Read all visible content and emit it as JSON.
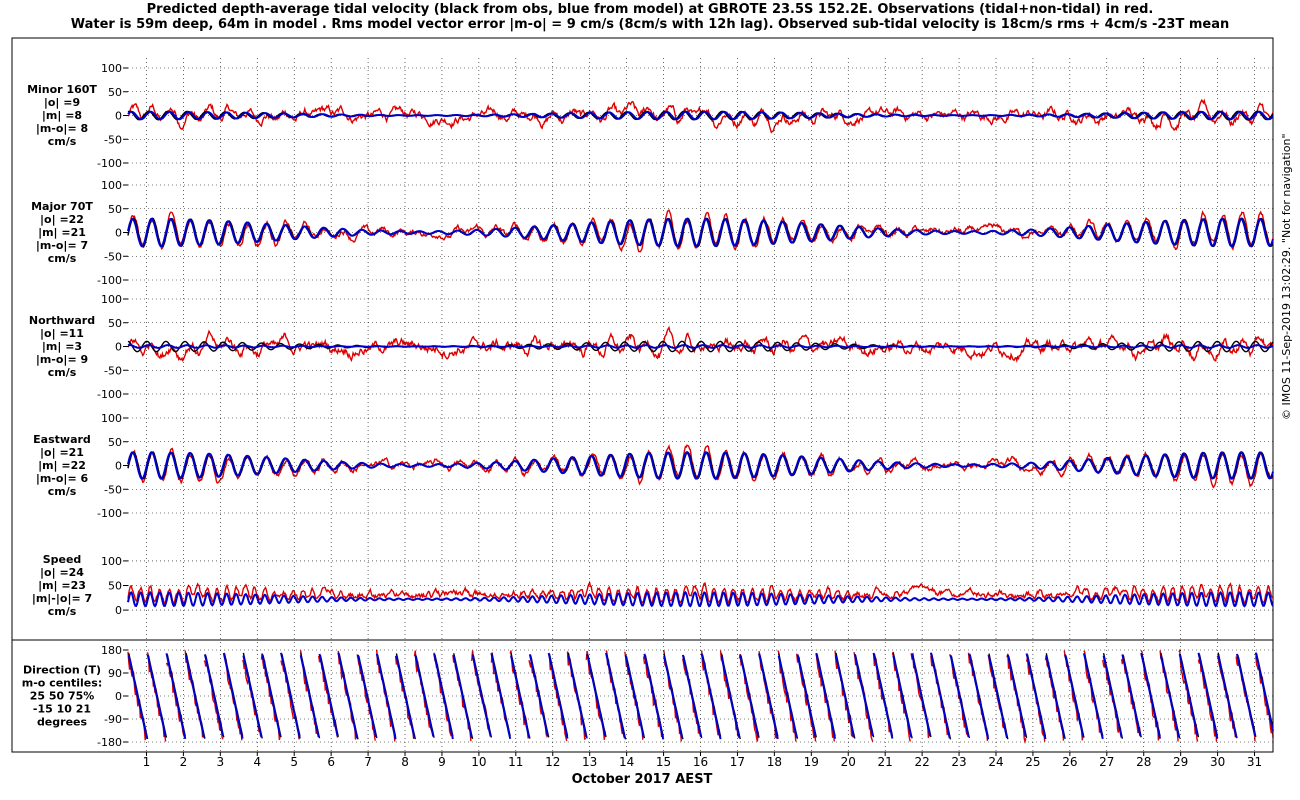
{
  "title": {
    "line1": "Predicted depth-average tidal velocity (black from obs, blue from model) at GBROTE 23.5S 152.2E. Observations (tidal+non-tidal) in red.",
    "line2": "Water is 59m deep, 64m in model . Rms model vector error |m-o| = 9 cm/s (8cm/s with 12h lag). Observed sub-tidal velocity is 18cm/s rms + 4cm/s -23T mean"
  },
  "footer": "© IMOS 11-Sep-2019 13:02:29. \"Not for navigation\"",
  "colors": {
    "obs": "#000000",
    "model": "#0000cc",
    "observations_total": "#dd0000",
    "grid": "#000000"
  },
  "chart_data": [
    {
      "type": "line",
      "panel": "minor",
      "labels": [
        "Minor 160T",
        "|o| =9",
        "|m| =8",
        "|m-o|= 8",
        "cm/s"
      ],
      "yticks": [
        100,
        50,
        0,
        -50,
        -100
      ],
      "ylim": [
        -100,
        100
      ],
      "x": {
        "start_day": 0.5,
        "end_day": 31.5
      },
      "series": [
        {
          "name": "black from obs",
          "color": "#000000",
          "amp": 9,
          "phase": 0.2
        },
        {
          "name": "blue from model",
          "color": "#0000cc",
          "amp": 8,
          "phase": 0.1
        },
        {
          "name": "Observations (tidal+non-tidal)",
          "color": "#dd0000",
          "amp": 12,
          "noise": 25
        }
      ]
    },
    {
      "type": "line",
      "panel": "major",
      "labels": [
        "Major 70T",
        "|o| =22",
        "|m| =21",
        "|m-o|= 7",
        "cm/s"
      ],
      "yticks": [
        100,
        50,
        0,
        -50,
        -100
      ],
      "ylim": [
        -100,
        100
      ],
      "series": [
        {
          "name": "black from obs",
          "color": "#000000",
          "amp": 30,
          "phase": 0.0
        },
        {
          "name": "blue from model",
          "color": "#0000cc",
          "amp": 29,
          "phase": 0.05
        },
        {
          "name": "Observations (tidal+non-tidal)",
          "color": "#dd0000",
          "amp": 32,
          "noise": 18
        }
      ]
    },
    {
      "type": "line",
      "panel": "northward",
      "labels": [
        "Northward",
        "|o| =11",
        "|m| =3",
        "|m-o|= 9",
        "cm/s"
      ],
      "yticks": [
        100,
        50,
        0,
        -50,
        -100
      ],
      "ylim": [
        -100,
        100
      ],
      "series": [
        {
          "name": "black from obs",
          "color": "#000000",
          "amp": 11,
          "phase": 0.3
        },
        {
          "name": "blue from model",
          "color": "#0000cc",
          "amp": 3,
          "phase": 0.2
        },
        {
          "name": "Observations (tidal+non-tidal)",
          "color": "#dd0000",
          "amp": 12,
          "noise": 28
        }
      ]
    },
    {
      "type": "line",
      "panel": "eastward",
      "labels": [
        "Eastward",
        "|o| =21",
        "|m| =22",
        "|m-o|= 6",
        "cm/s"
      ],
      "yticks": [
        100,
        50,
        0,
        -50,
        -100
      ],
      "ylim": [
        -100,
        100
      ],
      "series": [
        {
          "name": "black from obs",
          "color": "#000000",
          "amp": 28,
          "phase": 0.0
        },
        {
          "name": "blue from model",
          "color": "#0000cc",
          "amp": 28,
          "phase": 0.05
        },
        {
          "name": "Observations (tidal+non-tidal)",
          "color": "#dd0000",
          "amp": 30,
          "noise": 18
        }
      ]
    },
    {
      "type": "line",
      "panel": "speed",
      "labels": [
        "Speed",
        "|o| =24",
        "|m| =23",
        "|m|-|o|= 7",
        "cm/s"
      ],
      "yticks": [
        100,
        50,
        0
      ],
      "ylim": [
        -10,
        110
      ],
      "series": [
        {
          "name": "black from obs",
          "color": "#000000",
          "base": 22,
          "amp": 14,
          "phase": 0.0
        },
        {
          "name": "blue from model",
          "color": "#0000cc",
          "base": 22,
          "amp": 14,
          "phase": 0.05
        },
        {
          "name": "Observations (tidal+non-tidal)",
          "color": "#dd0000",
          "base": 26,
          "amp": 14,
          "noise": 20
        }
      ]
    },
    {
      "type": "line",
      "panel": "direction",
      "labels": [
        "Direction (T)",
        "m-o centiles:",
        " 25  50  75%",
        " -15  10  21",
        "degrees"
      ],
      "yticks": [
        180,
        90,
        0,
        -90,
        -180
      ],
      "ylim": [
        -180,
        180
      ],
      "series": [
        {
          "name": "black from obs",
          "color": "#000000"
        },
        {
          "name": "blue from model",
          "color": "#0000cc"
        },
        {
          "name": "Observations (tidal+non-tidal)",
          "color": "#dd0000"
        }
      ]
    }
  ],
  "xaxis": {
    "label": "October 2017 AEST",
    "ticks": [
      "1",
      "2",
      "3",
      "4",
      "5",
      "6",
      "7",
      "8",
      "9",
      "10",
      "11",
      "12",
      "13",
      "14",
      "15",
      "16",
      "17",
      "18",
      "19",
      "20",
      "21",
      "22",
      "23",
      "24",
      "25",
      "26",
      "27",
      "28",
      "29",
      "30",
      "31"
    ]
  }
}
